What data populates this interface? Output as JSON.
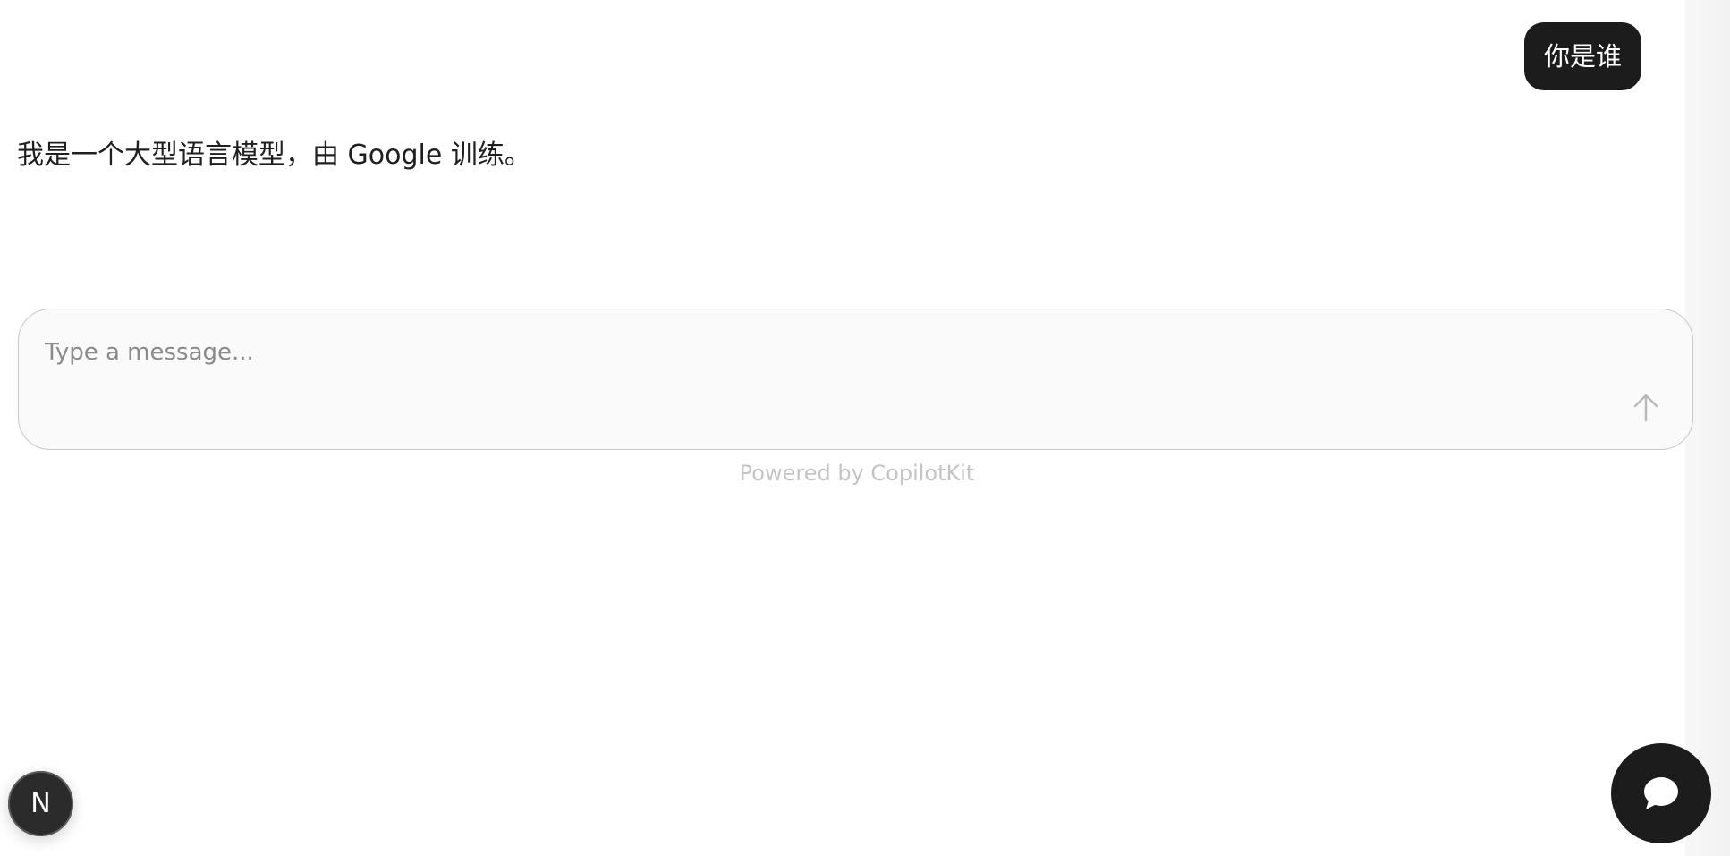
{
  "conversation": {
    "user_message": "你是谁",
    "assistant_message": "我是一个大型语言模型，由 Google 训练。"
  },
  "composer": {
    "placeholder": "Type a message...",
    "value": "",
    "send_icon": "arrow-up-icon"
  },
  "footer": {
    "powered_by": "Powered by CopilotKit"
  },
  "floating": {
    "next_badge_letter": "N",
    "launcher_icon": "chat-bubble-icon"
  },
  "colors": {
    "bubble_bg": "#1c1c1c",
    "input_border": "#c8c8c8",
    "input_bg": "#fafafa",
    "muted_text": "#c4c4c4"
  }
}
